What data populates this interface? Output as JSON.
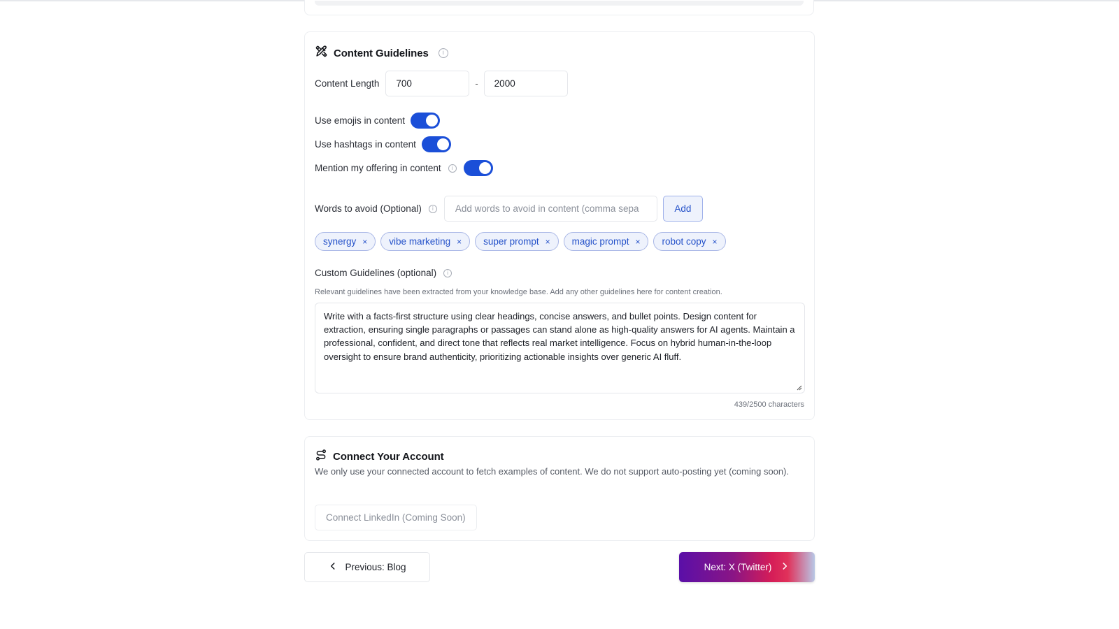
{
  "guidelines": {
    "title": "Content Guidelines",
    "content_length_label": "Content Length",
    "length_min": "700",
    "length_max": "2000",
    "length_separator": "-",
    "toggles": [
      {
        "label": "Use emojis in content",
        "on": true
      },
      {
        "label": "Use hashtags in content",
        "on": true
      },
      {
        "label": "Mention my offering in content",
        "on": true
      }
    ],
    "words_to_avoid_label": "Words to avoid (Optional)",
    "words_input_placeholder": "Add words to avoid in content (comma sepa",
    "add_label": "Add",
    "chips": [
      "synergy",
      "vibe marketing",
      "super prompt",
      "magic prompt",
      "robot copy"
    ],
    "chip_remove_glyph": "×",
    "custom_label": "Custom Guidelines (optional)",
    "custom_hint": "Relevant guidelines have been extracted from your knowledge base. Add any other guidelines here for content creation.",
    "custom_text": "Write with a facts-first structure using clear headings, concise answers, and bullet points. Design content for extraction, ensuring single paragraphs or passages can stand alone as high-quality answers for AI agents. Maintain a professional, confident, and direct tone that reflects real market intelligence. Focus on hybrid human-in-the-loop oversight to ensure brand authenticity, prioritizing actionable insights over generic AI fluff.",
    "char_count": "439/2500 characters"
  },
  "connect": {
    "title": "Connect Your Account",
    "description": "We only use your connected account to fetch examples of content. We do not support auto-posting yet (coming soon).",
    "linkedin_button": "Connect LinkedIn (Coming Soon)"
  },
  "nav": {
    "prev_label": "Previous: Blog",
    "next_label": "Next: X (Twitter)"
  },
  "colors": {
    "accent": "#1b4fd8",
    "chip_bg": "#eef2fc",
    "chip_text": "#2451c9"
  },
  "icons": {
    "guidelines": "pencil-ruler-icon",
    "connect": "route-link-icon",
    "info": "info-icon"
  }
}
